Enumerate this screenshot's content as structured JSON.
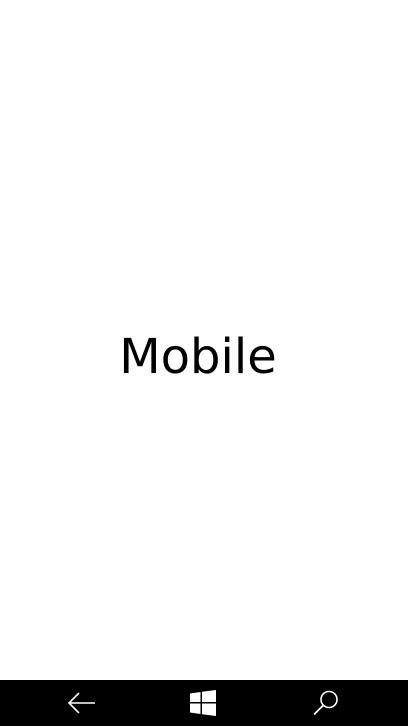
{
  "main": {
    "title": "Mobile",
    "background": "#ffffff",
    "text_color": "#000000"
  },
  "nav_bar": {
    "background": "#000000",
    "icon_color": "#ffffff",
    "buttons": [
      {
        "name": "back",
        "icon": "back-arrow-icon"
      },
      {
        "name": "start",
        "icon": "windows-logo-icon"
      },
      {
        "name": "search",
        "icon": "search-icon"
      }
    ]
  }
}
